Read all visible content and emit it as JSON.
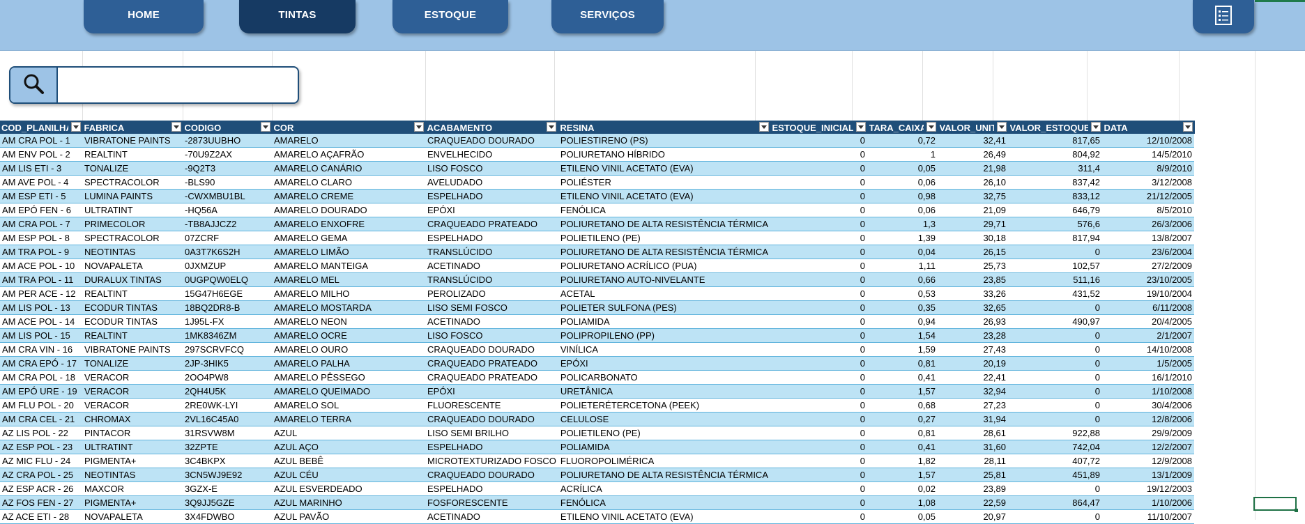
{
  "nav": {
    "home": "HOME",
    "tintas": "TINTAS",
    "estoque": "ESTOQUE",
    "servicos": "SERVIÇOS",
    "report_icon": "report-list-icon"
  },
  "search": {
    "icon": "magnifier-icon",
    "value": "",
    "placeholder": ""
  },
  "table": {
    "headers": [
      "COD_PLANILHA",
      "FABRICA",
      "CODIGO",
      "COR",
      "ACABAMENTO",
      "RESINA",
      "ESTOQUE_INICIAL",
      "TARA_CAIXA",
      "VALOR_UNIT",
      "VALOR_ESTOQUE",
      "DATA"
    ],
    "rows": [
      [
        "AM CRA POL - 1",
        "VIBRATONE PAINTS",
        "-2873UUBHO",
        "AMARELO",
        "CRAQUEADO DOURADO",
        "POLIESTIRENO (PS)",
        "0",
        "0,72",
        "32,41",
        "817,65",
        "12/10/2008"
      ],
      [
        "AM ENV POL - 2",
        "REALTINT",
        "-70U9Z2AX",
        "AMARELO AÇAFRÃO",
        "ENVELHECIDO",
        "POLIURETANO HÍBRIDO",
        "0",
        "1",
        "26,49",
        "804,92",
        "14/5/2010"
      ],
      [
        "AM LIS ETI - 3",
        "TONALIZE",
        "-9Q2T3",
        "AMARELO CANÁRIO",
        "LISO FOSCO",
        "ETILENO VINIL ACETATO (EVA)",
        "0",
        "0,05",
        "21,98",
        "311,4",
        "8/9/2010"
      ],
      [
        "AM AVE POL - 4",
        "SPECTRACOLOR",
        "-BLS90",
        "AMARELO CLARO",
        "AVELUDADO",
        "POLIÉSTER",
        "0",
        "0,06",
        "26,10",
        "837,42",
        "3/12/2008"
      ],
      [
        "AM ESP ETI - 5",
        "LUMINA PAINTS",
        "-CWXMBU1BL",
        "AMARELO CREME",
        "ESPELHADO",
        "ETILENO VINIL ACETATO (EVA)",
        "0",
        "0,98",
        "32,75",
        "833,12",
        "21/12/2005"
      ],
      [
        "AM EPÓ FEN - 6",
        "ULTRATINT",
        "-HQ56A",
        "AMARELO DOURADO",
        "EPÓXI",
        "FENÓLICA",
        "0",
        "0,06",
        "21,09",
        "646,79",
        "8/5/2010"
      ],
      [
        "AM CRA POL - 7",
        "PRIMECOLOR",
        "-TB8AJJCZ2",
        "AMARELO ENXOFRE",
        "CRAQUEADO PRATEADO",
        "POLIURETANO DE ALTA RESISTÊNCIA TÉRMICA",
        "0",
        "1,3",
        "29,71",
        "576,6",
        "26/3/2006"
      ],
      [
        "AM ESP POL - 8",
        "SPECTRACOLOR",
        "07ZCRF",
        "AMARELO GEMA",
        "ESPELHADO",
        "POLIETILENO (PE)",
        "0",
        "1,39",
        "30,18",
        "817,94",
        "13/8/2007"
      ],
      [
        "AM TRA POL - 9",
        "NEOTINTAS",
        "0A3T7K6S2H",
        "AMARELO LIMÃO",
        "TRANSLÚCIDO",
        "POLIURETANO DE ALTA RESISTÊNCIA TÉRMICA",
        "0",
        "0,04",
        "26,15",
        "0",
        "23/6/2004"
      ],
      [
        "AM ACE POL - 10",
        "NOVAPALETA",
        "0JXMZUP",
        "AMARELO MANTEIGA",
        "ACETINADO",
        "POLIURETANO ACRÍLICO (PUA)",
        "0",
        "1,11",
        "25,73",
        "102,57",
        "27/2/2009"
      ],
      [
        "AM TRA POL - 11",
        "DURALUX TINTAS",
        "0UGPQW0ELQ",
        "AMARELO MEL",
        "TRANSLÚCIDO",
        "POLIURETANO AUTO-NIVELANTE",
        "0",
        "0,66",
        "23,85",
        "511,16",
        "23/10/2005"
      ],
      [
        "AM PER ACE - 12",
        "REALTINT",
        "15G47H6EGE",
        "AMARELO MILHO",
        "PEROLIZADO",
        "ACETAL",
        "0",
        "0,53",
        "33,26",
        "431,52",
        "19/10/2004"
      ],
      [
        "AM LIS POL - 13",
        "ECODUR TINTAS",
        "18BQ2DR8-B",
        "AMARELO MOSTARDA",
        "LISO SEMI FOSCO",
        "POLIETER SULFONA (PES)",
        "0",
        "0,35",
        "32,65",
        "0",
        "6/11/2008"
      ],
      [
        "AM ACE POL - 14",
        "ECODUR TINTAS",
        "1J95L-FX",
        "AMARELO NEON",
        "ACETINADO",
        "POLIAMIDA",
        "0",
        "0,94",
        "26,93",
        "490,97",
        "20/4/2005"
      ],
      [
        "AM LIS POL - 15",
        "REALTINT",
        "1MK8346ZM",
        "AMARELO OCRE",
        "LISO FOSCO",
        "POLIPROPILENO (PP)",
        "0",
        "1,54",
        "23,28",
        "0",
        "2/1/2007"
      ],
      [
        "AM CRA VIN - 16",
        "VIBRATONE PAINTS",
        "297SCRVFCQ",
        "AMARELO OURO",
        "CRAQUEADO DOURADO",
        "VINÍLICA",
        "0",
        "1,59",
        "27,43",
        "0",
        "14/10/2008"
      ],
      [
        "AM CRA EPÓ - 17",
        "TONALIZE",
        "2JP-3HIK5",
        "AMARELO PALHA",
        "CRAQUEADO PRATEADO",
        "EPÓXI",
        "0",
        "0,81",
        "20,19",
        "0",
        "1/5/2005"
      ],
      [
        "AM CRA POL - 18",
        "VERACOR",
        "2OO4PW8",
        "AMARELO PÊSSEGO",
        "CRAQUEADO PRATEADO",
        "POLICARBONATO",
        "0",
        "0,41",
        "22,41",
        "0",
        "16/1/2010"
      ],
      [
        "AM EPÓ URE - 19",
        "VERACOR",
        "2QH4U5K",
        "AMARELO QUEIMADO",
        "EPÓXI",
        "URETÂNICA",
        "0",
        "1,57",
        "32,94",
        "0",
        "1/10/2008"
      ],
      [
        "AM FLU POL - 20",
        "VERACOR",
        "2RE0WK-LYI",
        "AMARELO SOL",
        "FLUORESCENTE",
        "POLIETERÉTERCETONA (PEEK)",
        "0",
        "0,68",
        "27,23",
        "0",
        "30/4/2006"
      ],
      [
        "AM CRA CEL - 21",
        "CHROMAX",
        "2VL16C45A0",
        "AMARELO TERRA",
        "CRAQUEADO DOURADO",
        "CELULOSE",
        "0",
        "0,27",
        "31,94",
        "0",
        "12/8/2006"
      ],
      [
        "AZ LIS POL - 22",
        "PINTACOR",
        "31RSVW8M",
        "AZUL",
        "LISO SEMI BRILHO",
        "POLIETILENO (PE)",
        "0",
        "0,81",
        "28,61",
        "922,88",
        "29/9/2009"
      ],
      [
        "AZ ESP POL - 23",
        "ULTRATINT",
        "32ZPTE",
        "AZUL AÇO",
        "ESPELHADO",
        "POLIAMIDA",
        "0",
        "0,41",
        "31,60",
        "742,04",
        "12/2/2007"
      ],
      [
        "AZ MIC FLU - 24",
        "PIGMENTA+",
        "3C4BKPX",
        "AZUL BEBÊ",
        "MICROTEXTURIZADO FOSCO",
        "FLUOROPOLIMÉRICA",
        "0",
        "1,82",
        "28,11",
        "407,72",
        "12/9/2008"
      ],
      [
        "AZ CRA POL - 25",
        "NEOTINTAS",
        "3CN5WJ9E92",
        "AZUL CÉU",
        "CRAQUEADO DOURADO",
        "POLIURETANO DE ALTA RESISTÊNCIA TÉRMICA",
        "0",
        "1,57",
        "25,81",
        "451,89",
        "13/1/2009"
      ],
      [
        "AZ ESP ACR - 26",
        "MAXCOR",
        "3GZX-E",
        "AZUL ESVERDEADO",
        "ESPELHADO",
        "ACRÍLICA",
        "0",
        "0,02",
        "23,89",
        "0",
        "19/12/2003"
      ],
      [
        "AZ FOS FEN - 27",
        "PIGMENTA+",
        "3Q9JJ5GZE",
        "AZUL MARINHO",
        "FOSFORESCENTE",
        "FENÓLICA",
        "0",
        "1,08",
        "22,59",
        "864,47",
        "1/10/2006"
      ],
      [
        "AZ ACE ETI - 28",
        "NOVAPALETA",
        "3X4FDWBO",
        "AZUL PAVÃO",
        "ACETINADO",
        "ETILENO VINIL ACETATO (EVA)",
        "0",
        "0,05",
        "20,97",
        "0",
        "11/10/2007"
      ]
    ]
  },
  "colors": {
    "header_band": "#9dc3e6",
    "nav_button": "#2e5f96",
    "nav_button_active": "#163a63",
    "table_header": "#1f4e79",
    "row_band": "#bde3f5"
  }
}
